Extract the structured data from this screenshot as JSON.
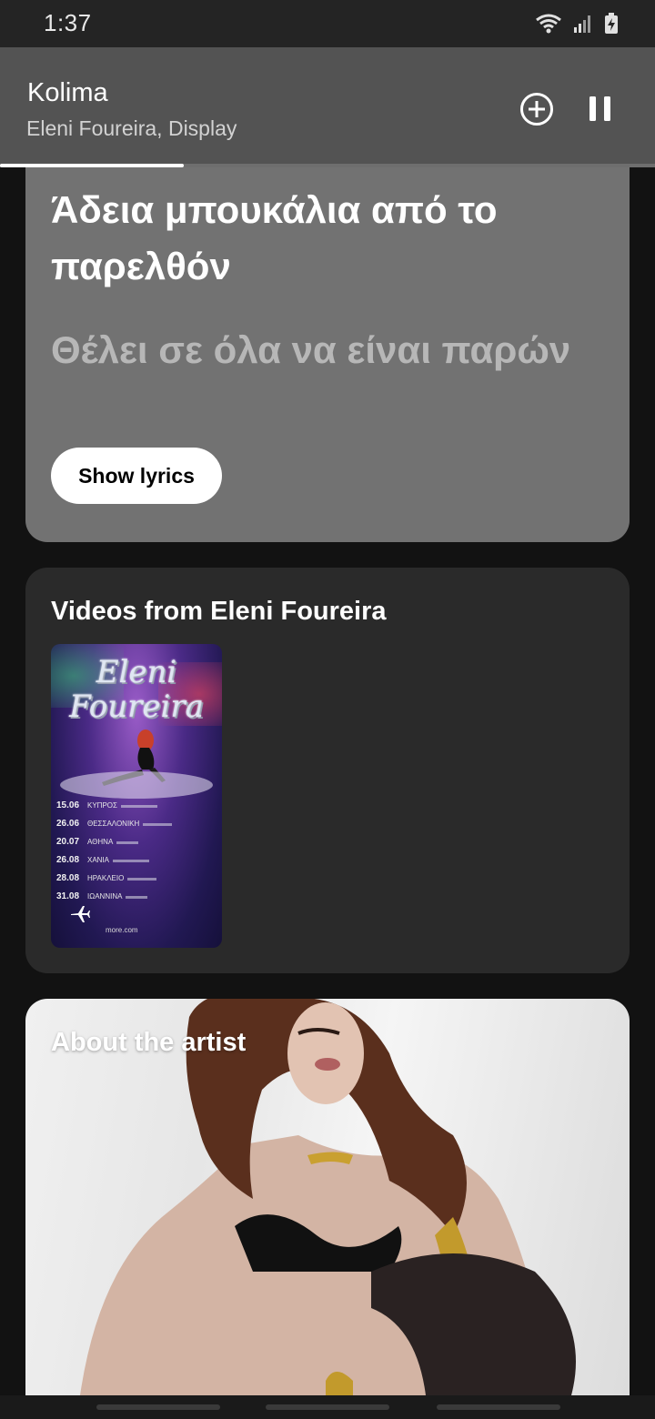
{
  "status_bar": {
    "time": "1:37",
    "icons": [
      "wifi-icon",
      "signal-icon",
      "battery-charging-icon"
    ]
  },
  "player": {
    "title": "Kolima",
    "artist": "Eleni Foureira, Display",
    "progress": 0.28,
    "add_icon": "plus-circle-icon",
    "pause_icon": "pause-icon"
  },
  "lyrics": {
    "line_1": "Άδεια μπουκάλια από το παρελθόν",
    "line_2": "Θέλει σε όλα να είναι παρών",
    "button_label": "Show lyrics"
  },
  "videos": {
    "section_title": "Videos from Eleni Foureira",
    "thumbnail": {
      "logo_text": "Eleni Foureira",
      "tour_dates": [
        {
          "date": "15.06",
          "city": "ΚΥΠΡΟΣ"
        },
        {
          "date": "26.06",
          "city": "ΘΕΣΣΑΛΟΝΙΚΗ"
        },
        {
          "date": "20.07",
          "city": "ΑΘΗΝΑ"
        },
        {
          "date": "26.08",
          "city": "ΧΑΝΙΑ"
        },
        {
          "date": "28.08",
          "city": "ΗΡΑΚΛΕΙΟ"
        },
        {
          "date": "31.08",
          "city": "ΙΩΑΝΝΙΝΑ"
        }
      ],
      "site": "more.com"
    }
  },
  "about": {
    "section_title": "About the artist"
  },
  "colors": {
    "background": "#121212",
    "mini_player": "#535353",
    "lyrics_card": "#727272",
    "videos_card": "#2a2a2a"
  }
}
